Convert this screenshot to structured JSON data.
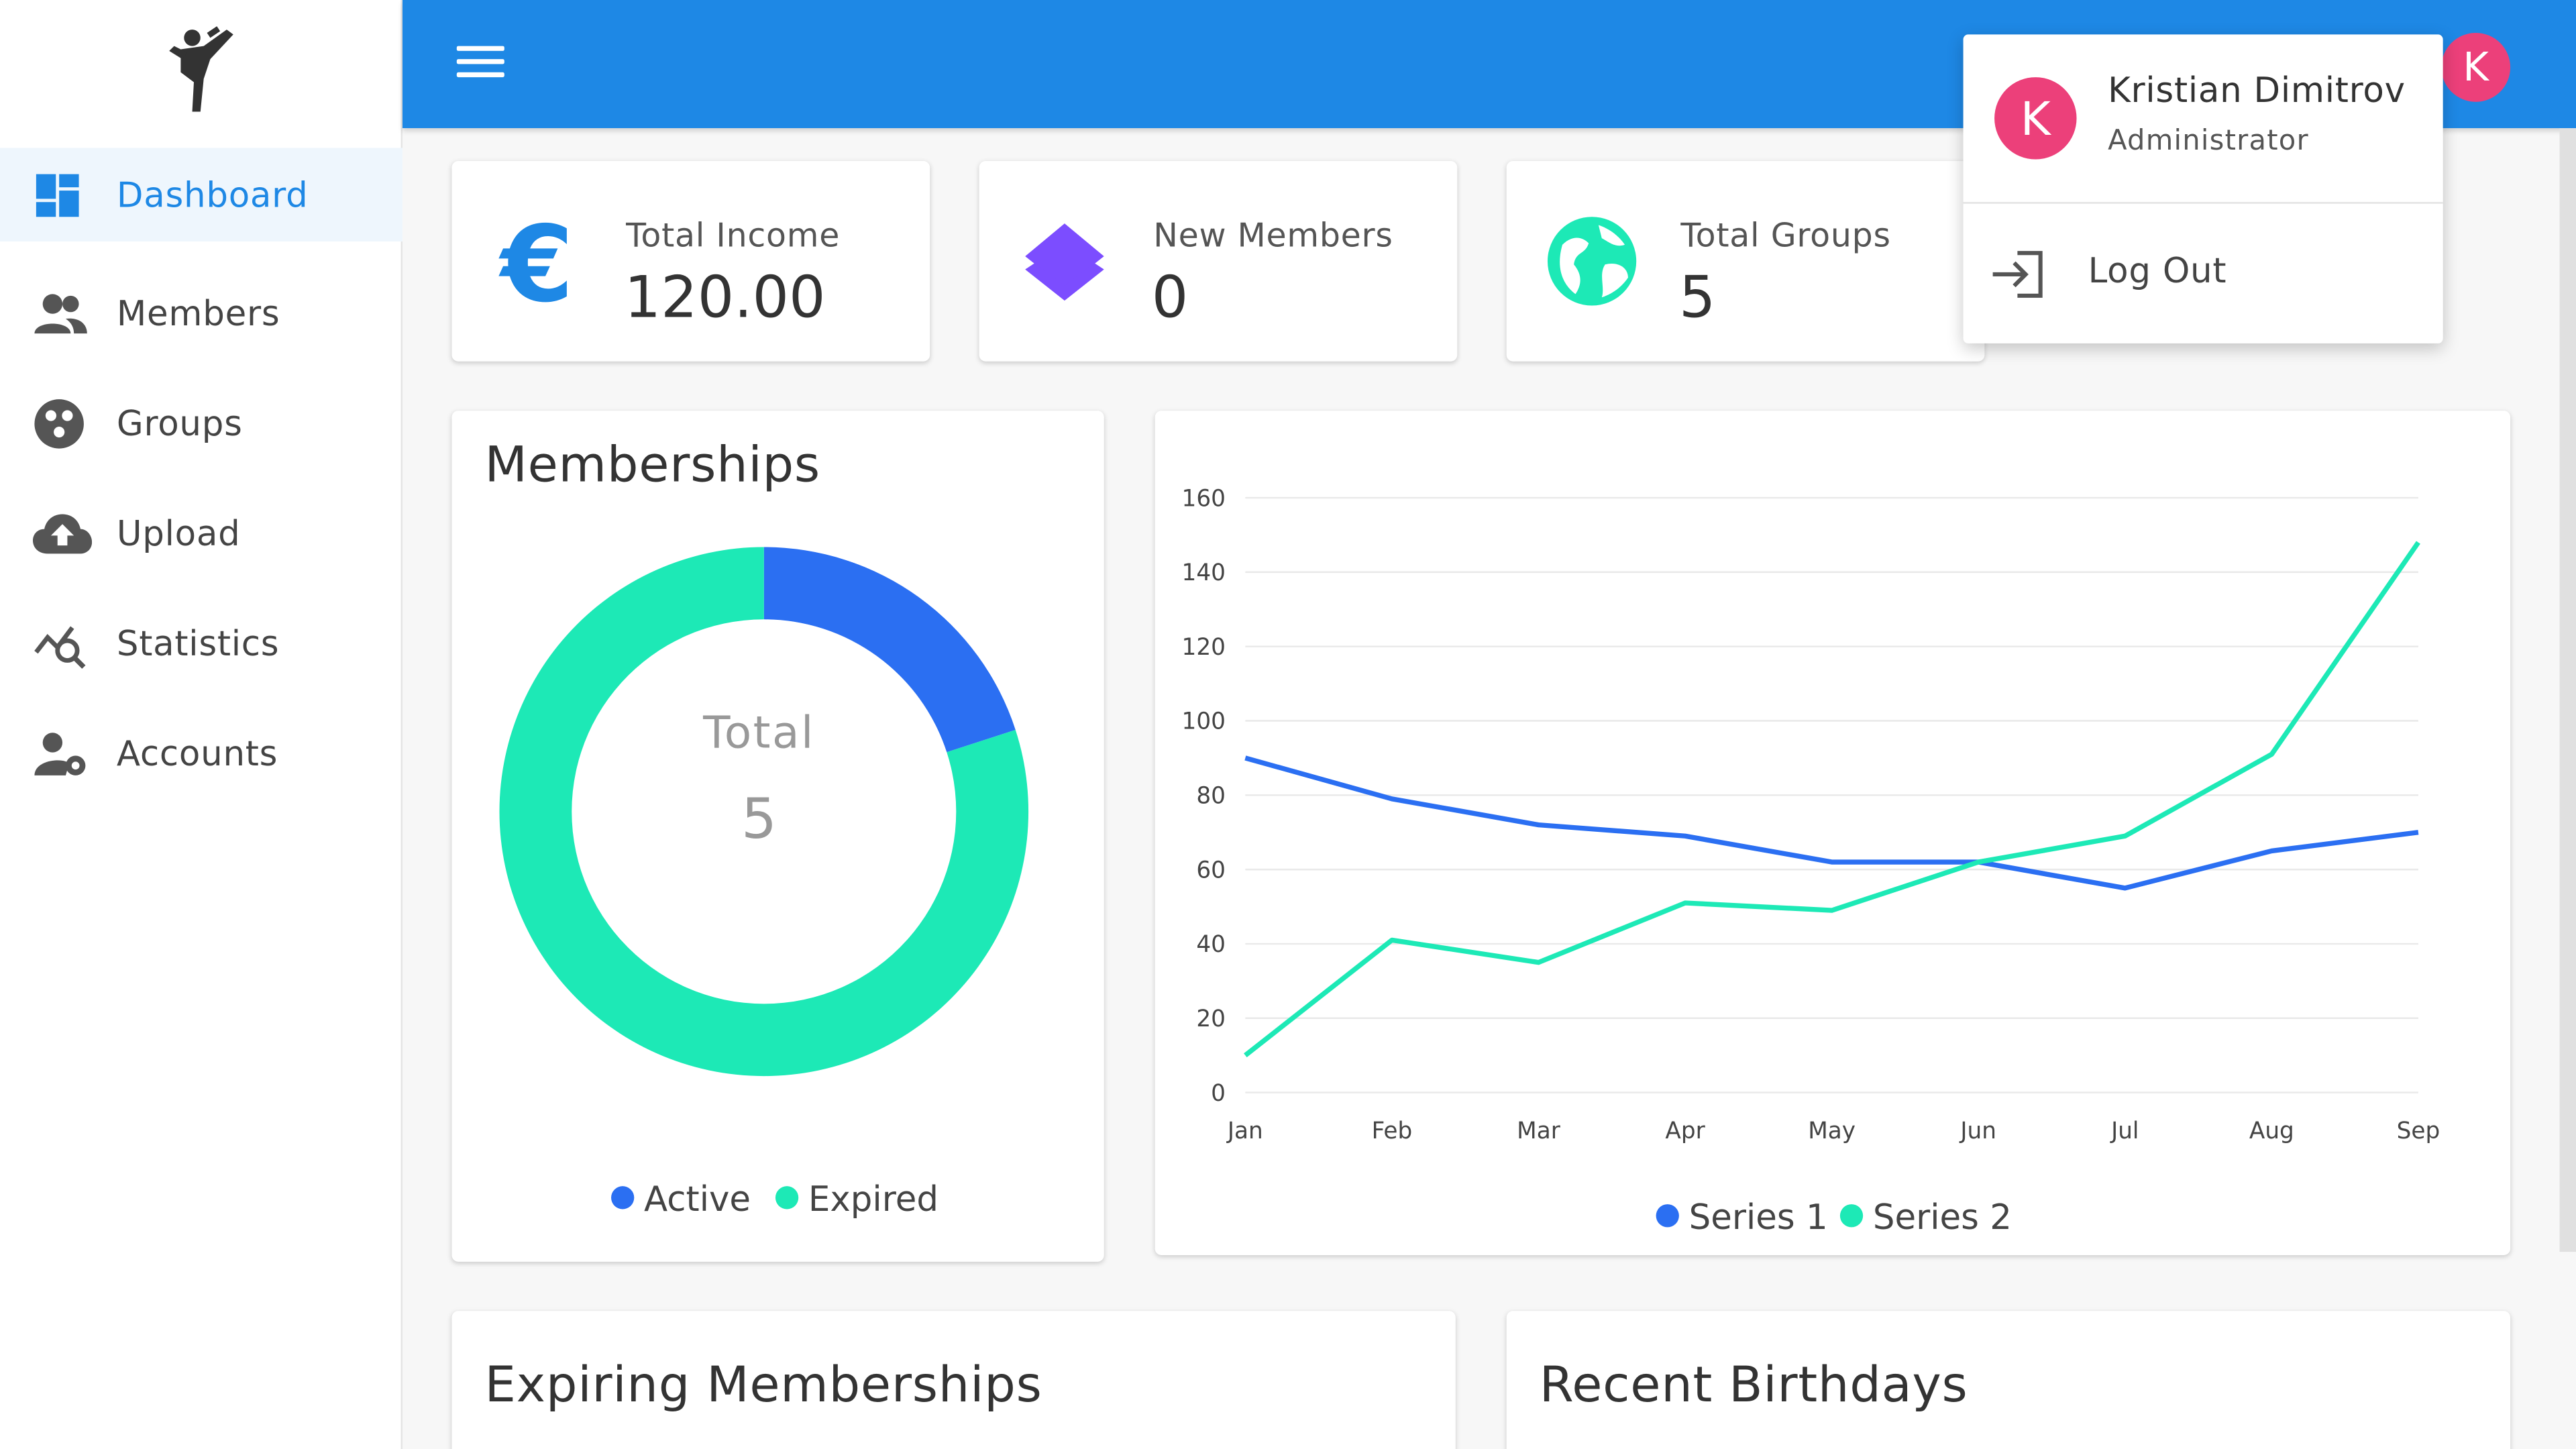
{
  "sidebar": {
    "items": [
      {
        "label": "Dashboard",
        "icon": "dashboard-icon",
        "active": true
      },
      {
        "label": "Members",
        "icon": "people-icon"
      },
      {
        "label": "Groups",
        "icon": "groups-icon"
      },
      {
        "label": "Upload",
        "icon": "cloud-upload-icon"
      },
      {
        "label": "Statistics",
        "icon": "statistics-icon"
      },
      {
        "label": "Accounts",
        "icon": "accounts-icon"
      }
    ]
  },
  "header": {
    "avatar_letter": "K"
  },
  "stats": [
    {
      "label": "Total Income",
      "value": "120.00",
      "icon": "euro-icon"
    },
    {
      "label": "New Members",
      "value": "0",
      "icon": "layers-icon"
    },
    {
      "label": "Total Groups",
      "value": "5",
      "icon": "globe-icon"
    }
  ],
  "user_menu": {
    "avatar_letter": "K",
    "name": "Kristian Dimitrov",
    "role": "Administrator",
    "logout_label": "Log Out"
  },
  "memberships": {
    "title": "Memberships",
    "center_label": "Total",
    "center_value": "5"
  },
  "sections": {
    "expiring": "Expiring Memberships",
    "birthdays": "Recent Birthdays"
  },
  "colors": {
    "primary": "#1e88e5",
    "series1": "#2b6ff2",
    "series2": "#1de9b6",
    "avatar": "#ec407a",
    "layers": "#7c4dff"
  },
  "chart_data": [
    {
      "type": "pie",
      "title": "Memberships",
      "categories": [
        "Active",
        "Expired"
      ],
      "values": [
        1,
        4
      ],
      "colors": [
        "#2b6ff2",
        "#1de9b6"
      ],
      "legend": "bottom"
    },
    {
      "type": "line",
      "title": "",
      "categories": [
        "Jan",
        "Feb",
        "Mar",
        "Apr",
        "May",
        "Jun",
        "Jul",
        "Aug",
        "Sep"
      ],
      "series": [
        {
          "name": "Series 1",
          "values": [
            90,
            79,
            72,
            69,
            62,
            62,
            55,
            65,
            70
          ],
          "color": "#2b6ff2"
        },
        {
          "name": "Series 2",
          "values": [
            10,
            41,
            35,
            51,
            49,
            62,
            69,
            91,
            148
          ],
          "color": "#1de9b6"
        }
      ],
      "yticks": [
        0,
        20,
        40,
        60,
        80,
        100,
        120,
        140,
        160
      ],
      "ylim": [
        0,
        160
      ],
      "grid": true,
      "legend": "bottom"
    }
  ]
}
